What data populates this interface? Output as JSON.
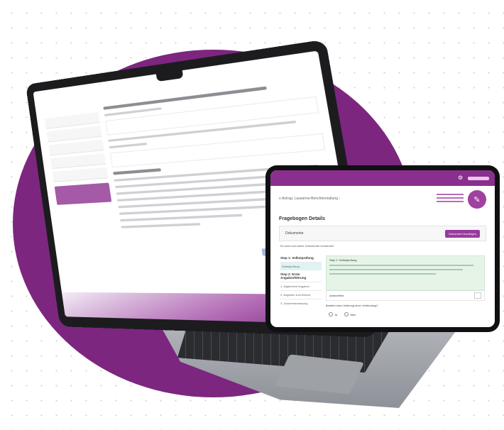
{
  "tablet": {
    "breadcrumb": "≡ Antrag: Lausanne-Berichterstattung ›",
    "page_title": "Fragebogen Details",
    "section_title": "Dokumente",
    "documents_button": "Dokument hinzufügen",
    "note": "Es sind noch keine Dokumente vorhanden",
    "steps": [
      {
        "type": "head",
        "label": "Step 1: Selbstprüfung"
      },
      {
        "type": "item",
        "label": "Selbstprüfung",
        "active": true
      },
      {
        "type": "head",
        "label": "Step 2: Erste Angabenführung"
      },
      {
        "type": "item",
        "label": "1. Allgemeine Angaben"
      },
      {
        "type": "item",
        "label": "2. Angaben zum Bericht"
      },
      {
        "type": "item",
        "label": "3. Zusammenfassung"
      }
    ],
    "info_heading": "Step 1: Selbstprüfung",
    "field_label": "Antwortfeld",
    "question": "Besteht eine Lieferung einer Verbindung?",
    "radio_no": "Ja",
    "radio_yes": "Nein",
    "topbar_icon": "settings-icon",
    "logo_icon": "seal-logo"
  },
  "colors": {
    "brand": "#7c267f",
    "brand_light": "#a45aa6",
    "info_bg": "#e6f4e8"
  }
}
